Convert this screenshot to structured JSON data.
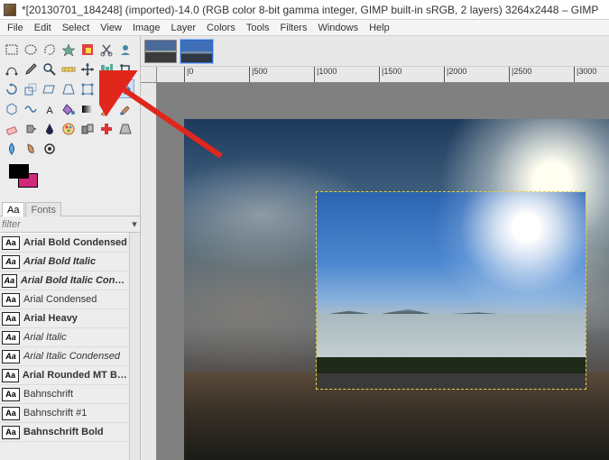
{
  "title": "*[20130701_184248] (imported)-14.0 (RGB color 8-bit gamma integer, GIMP built-in sRGB, 2 layers) 3264x2448 – GIMP",
  "menu": {
    "file": "File",
    "edit": "Edit",
    "select": "Select",
    "view": "View",
    "image": "Image",
    "layer": "Layer",
    "colors": "Colors",
    "tools": "Tools",
    "filters": "Filters",
    "windows": "Windows",
    "help": "Help"
  },
  "tools": {
    "row1": [
      "rect-select",
      "ellipse-select",
      "free-select",
      "fuzzy-select",
      "color-select",
      "scissors",
      "foreground-select"
    ],
    "row2": [
      "paths",
      "color-picker",
      "zoom",
      "measure",
      "move",
      "align",
      "crop"
    ],
    "row3": [
      "rotate",
      "scale",
      "shear",
      "perspective",
      "unified-transform",
      "handle-transform",
      "flip"
    ],
    "row4": [
      "cage",
      "warp",
      "text",
      "bucket-fill",
      "gradient",
      "pencil",
      "paintbrush"
    ],
    "row5": [
      "eraser",
      "airbrush",
      "ink",
      "mypaint",
      "clone",
      "heal",
      "perspective-clone"
    ],
    "row6": [
      "blur",
      "smudge",
      "dodge",
      "",
      "",
      "",
      ""
    ]
  },
  "selected_tool": "flip",
  "swatches": {
    "fg": "#000000",
    "bg": "#d12a7b"
  },
  "font_panel": {
    "tabs": {
      "aa": "Aa",
      "fonts": "Fonts"
    },
    "filter_placeholder": "filter",
    "fonts": [
      {
        "sample": "Aa",
        "name": "Arial Bold Condensed",
        "style": "font-weight:bold;font-stretch:condensed"
      },
      {
        "sample": "Aa",
        "name": "Arial Bold Italic",
        "style": "font-weight:bold;font-style:italic"
      },
      {
        "sample": "Aa",
        "name": "Arial Bold Italic Condensed",
        "style": "font-weight:bold;font-style:italic;font-stretch:condensed"
      },
      {
        "sample": "Aa",
        "name": "Arial Condensed",
        "style": "font-stretch:condensed"
      },
      {
        "sample": "Aa",
        "name": "Arial Heavy",
        "style": "font-weight:900"
      },
      {
        "sample": "Aa",
        "name": "Arial Italic",
        "style": "font-style:italic"
      },
      {
        "sample": "Aa",
        "name": "Arial Italic Condensed",
        "style": "font-style:italic;font-stretch:condensed"
      },
      {
        "sample": "Aa",
        "name": "Arial Rounded MT Bold,",
        "style": "font-weight:bold"
      },
      {
        "sample": "Aa",
        "name": "Bahnschrift",
        "style": ""
      },
      {
        "sample": "Aa",
        "name": "Bahnschrift #1",
        "style": ""
      },
      {
        "sample": "Aa",
        "name": "Bahnschrift Bold",
        "style": "font-weight:bold"
      }
    ]
  },
  "ruler": {
    "ticks": [
      "0",
      "500",
      "1000",
      "1500",
      "2000",
      "2500",
      "3000"
    ]
  },
  "thumbnails": {
    "count": 2,
    "active": 1
  }
}
